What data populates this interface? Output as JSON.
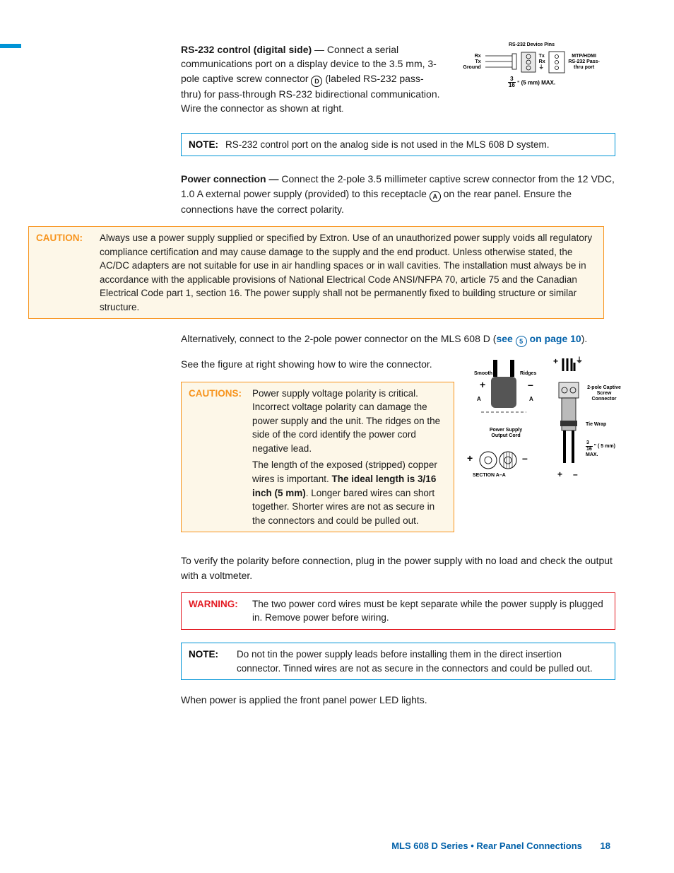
{
  "rs232": {
    "heading": "RS-232 control (digital side)",
    "body1": " — Connect a serial communications port on a display device to the 3.5 mm, 3-pole captive screw connector ",
    "circled": "D",
    "body2": " (labeled RS-232 pass-thru) for pass-through RS-232 bidirectional communication. Wire the connector as shown at right",
    "tail": "."
  },
  "diagram1": {
    "title": "RS-232 Device Pins",
    "rx": "Rx",
    "tx": "Tx",
    "ground": "Ground",
    "label": "MTP/HDMI RS-232 Pass-thru port",
    "max": "(5 mm) MAX.",
    "frac_top": "3",
    "frac_bot": "16"
  },
  "note1": {
    "label": "NOTE:",
    "body": "RS-232 control port on the analog side is not used in the MLS 608 D system."
  },
  "power": {
    "heading": "Power connection —",
    "body1": " Connect the 2-pole 3.5 millimeter captive screw connector from the 12 VDC, 1.0 A external power supply (provided) to this receptacle ",
    "circled": "A",
    "body2": " on the rear panel. Ensure the connections have the correct polarity."
  },
  "caution1": {
    "label": "CAUTION:",
    "body": "Always use a power supply supplied or specified by Extron. Use of an unauthorized power supply voids all regulatory compliance certification and may cause damage to the supply and the end product. Unless otherwise stated, the AC/DC adapters are not suitable for use in air handling spaces or in wall cavities. The installation must always be in accordance with the applicable provisions of National Electrical Code ANSI/NFPA 70, article 75 and the Canadian Electrical Code part 1, section 16. The power supply shall not be permanently fixed to building structure or similar structure."
  },
  "alt": {
    "body1": "Alternatively, connect to the 2-pole power connector on the MLS 608 D (",
    "link1": "see ",
    "circled": "5",
    "link2": " on page 10",
    "body2": ")."
  },
  "seefig": "See the figure at right showing how to wire the connector.",
  "caution2": {
    "label": "CAUTIONS:",
    "body1": "Power supply voltage polarity is critical. Incorrect voltage polarity can damage the power supply and the unit. The ridges on the side of the cord identify the power cord negative lead.",
    "body2a": "The length of the exposed (stripped) copper wires is important. ",
    "body2bold": "The ideal length is 3/16 inch (5 mm)",
    "body2b": ". Longer bared wires can short together. Shorter wires are not as secure in the connectors and could be pulled out."
  },
  "diagram2": {
    "smooth": "Smooth",
    "ridges": "Ridges",
    "a": "A",
    "cord": "Power Supply Output Cord",
    "section": "SECTION A–A",
    "conn": "2-pole Captive Screw Connector",
    "tie": "Tie Wrap",
    "max": "( 5 mm) MAX.",
    "frac_top": "3",
    "frac_bot": "16"
  },
  "verify": "To verify the polarity before connection, plug in the power supply with no load and check the output with a voltmeter.",
  "warning": {
    "label": "WARNING:",
    "body": "The two power cord wires must be kept separate while the power supply is plugged in. Remove power before wiring."
  },
  "note2": {
    "label": "NOTE:",
    "body": "Do not tin the power supply leads before installing them in the direct insertion connector. Tinned wires are not as secure in the connectors and could be pulled out."
  },
  "final": "When power is applied the front panel power LED lights.",
  "footer": {
    "title": "MLS 608 D Series • Rear Panel Connections",
    "page": "18"
  }
}
